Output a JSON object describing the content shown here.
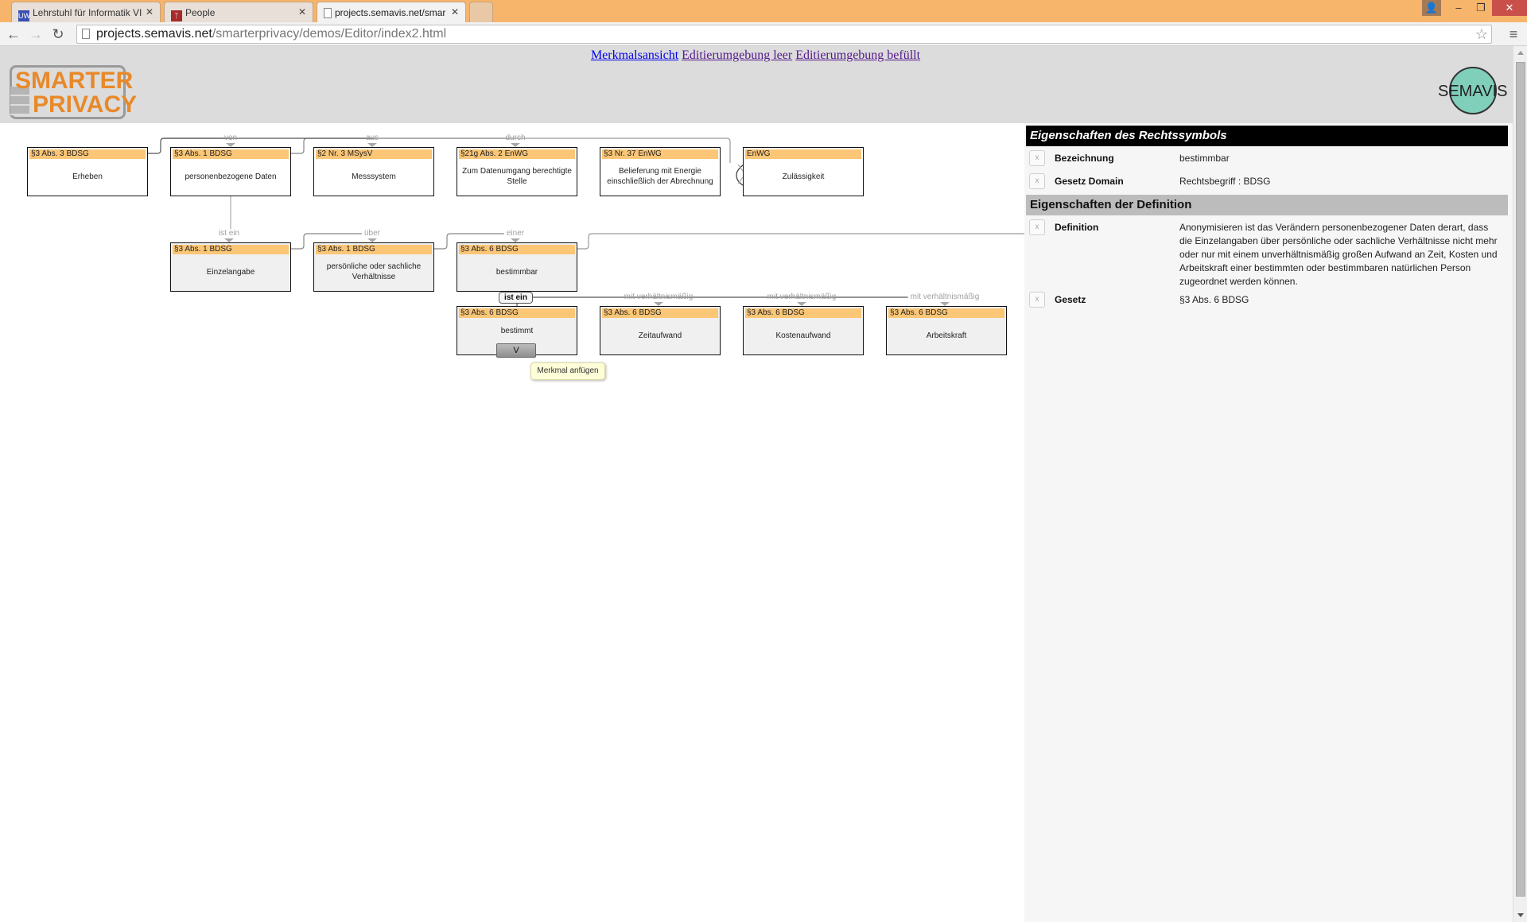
{
  "browser": {
    "tabs": [
      {
        "label": "Lehrstuhl für Informatik VI",
        "icon": "uw-favicon"
      },
      {
        "label": "People",
        "icon": "acrobat-favicon"
      },
      {
        "label": "projects.semavis.net/smar",
        "icon": "page-favicon",
        "active": true
      }
    ],
    "url_host": "projects.semavis.net",
    "url_path": "/smarterprivacy/demos/Editor/index2.html"
  },
  "header": {
    "links": [
      "Merkmalsansicht",
      "Editierumgebung leer",
      "Editierumgebung befüllt"
    ],
    "logo_left_line1": "SMARTER",
    "logo_left_line2": "PRIVACY",
    "logo_right": "SEMAVIS"
  },
  "graph": {
    "nodes": [
      {
        "law": "§3 Abs. 3 BDSG",
        "label": "Erheben"
      },
      {
        "law": "§3 Abs. 1 BDSG",
        "label": "personenbezogene Daten"
      },
      {
        "law": "§2 Nr. 3 MSysV",
        "label": "Messsystem"
      },
      {
        "law": "§21g Abs. 2 EnWG",
        "label": "Zum Datenumgang berechtigte Stelle"
      },
      {
        "law": "§3 Nr. 37 EnWG",
        "label": "Belieferung mit Energie einschließlich der Abrechnung"
      },
      {
        "law": "EnWG",
        "label": "Zulässigkeit"
      },
      {
        "law": "§3 Abs. 1 BDSG",
        "label": "Einzelangabe"
      },
      {
        "law": "§3 Abs. 1 BDSG",
        "label": "persönliche oder sachliche Verhältnisse"
      },
      {
        "law": "§3 Abs. 6 BDSG",
        "label": "bestimmbar"
      },
      {
        "law": "§3 Abs. 6 BDSG",
        "label": "bestimmt"
      },
      {
        "law": "§3 Abs. 6 BDSG",
        "label": "Zeitaufwand"
      },
      {
        "law": "§3 Abs. 6 BDSG",
        "label": "Kostenaufwand"
      },
      {
        "law": "§3 Abs. 6 BDSG",
        "label": "Arbeitskraft"
      }
    ],
    "edge_labels": [
      "von",
      "aus",
      "durch",
      "ist ein",
      "über",
      "einer",
      "mit verhältnismäßig",
      "mit verhältnismäßig",
      "mit verhältnismäßig"
    ],
    "selected_edge_label": "ist ein",
    "expand_button": "V",
    "tooltip": "Merkmal anfügen"
  },
  "panel": {
    "section1_title": "Eigenschaften des Rechtssymbols",
    "section2_title": "Eigenschaften der Definition",
    "remove_label": "x",
    "props1": [
      {
        "name": "Bezeichnung",
        "value": "bestimmbar"
      },
      {
        "name": "Gesetz Domain",
        "value": "Rechtsbegriff : BDSG"
      }
    ],
    "props2": [
      {
        "name": "Definition",
        "value": "Anonymisieren ist das Verändern personenbezogener Daten derart, dass die Einzelangaben über persönliche oder sachliche Verhältnisse nicht mehr oder nur mit einem unverhältnismäßig großen Aufwand an Zeit, Kosten und Arbeitskraft einer bestimmten oder bestimmbaren natürlichen Person zugeordnet werden können."
      },
      {
        "name": "Gesetz",
        "value": "§3 Abs. 6 BDSG"
      }
    ]
  },
  "colors": {
    "node_header": "#fbc676",
    "chrome_frame": "#f6b56b",
    "link": "#0000ee",
    "visited_link": "#551a8b"
  }
}
